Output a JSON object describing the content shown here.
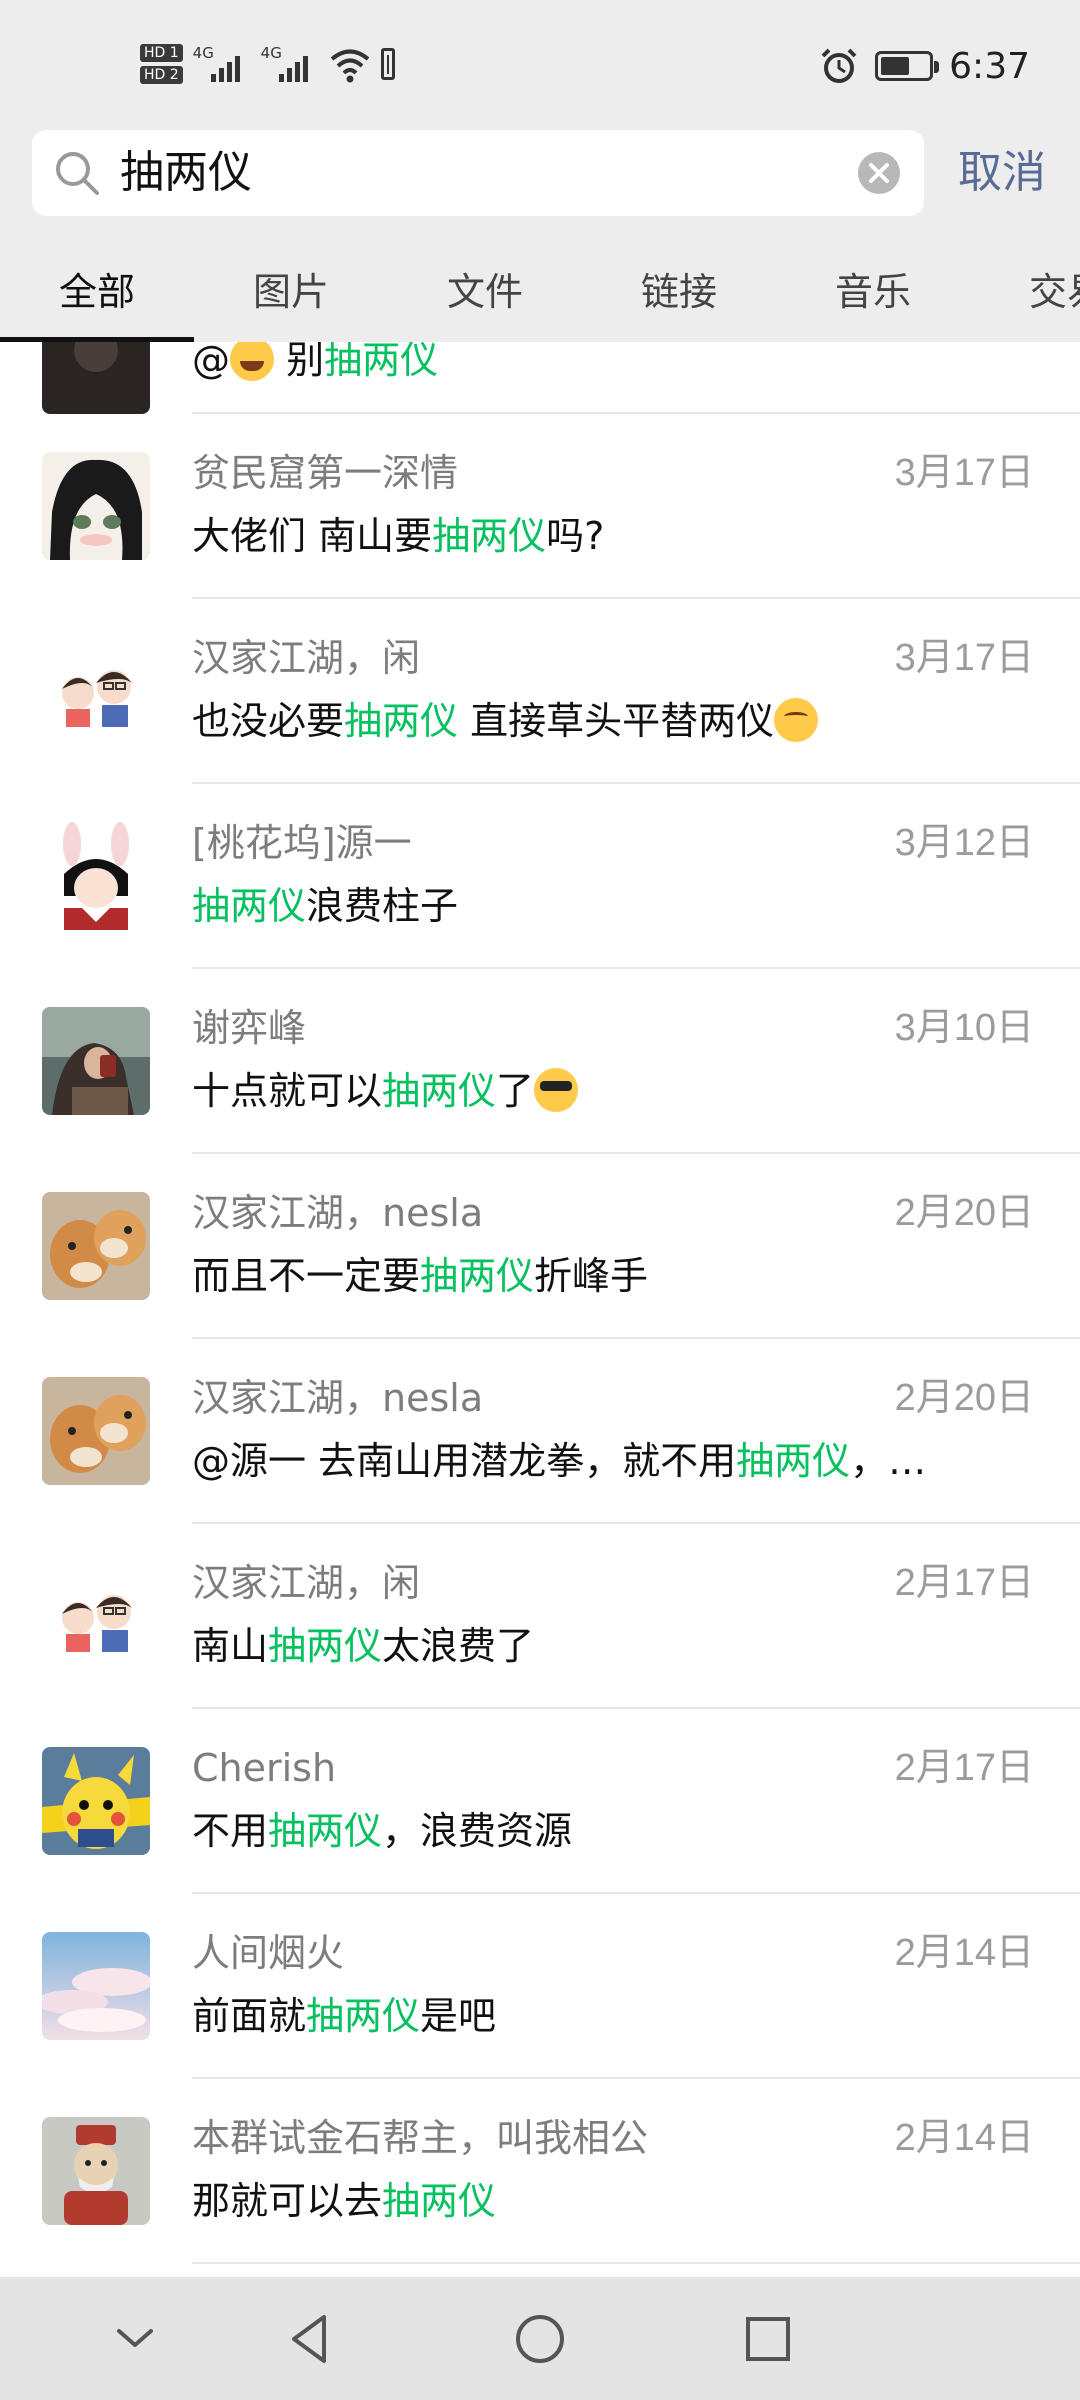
{
  "status_bar": {
    "sim_labels": [
      "HD 1",
      "HD 2"
    ],
    "network": [
      "4G",
      "4G"
    ],
    "battery_level": 0.6,
    "time": "6:37"
  },
  "search": {
    "query": "抽两仪",
    "cancel_label": "取消"
  },
  "tabs": [
    "全部",
    "图片",
    "文件",
    "链接",
    "音乐",
    "交易"
  ],
  "active_tab": "全部",
  "accent": "#07c160",
  "results": [
    {
      "name": "",
      "date": "",
      "msg_pre": "@",
      "emoji_mid": "laugh",
      "msg_mid": " 别",
      "highlight": "抽两仪",
      "msg_post": "",
      "emoji_end": "",
      "avatar": "dark"
    },
    {
      "name": "贫民窟第一深情",
      "date": "3月17日",
      "msg_pre": "大佬们 南山要",
      "highlight": "抽两仪",
      "msg_post": "吗?",
      "emoji_end": "",
      "avatar": "anime-girl"
    },
    {
      "name": "汉家江湖，闲",
      "date": "3月17日",
      "msg_pre": "也没必要",
      "highlight": "抽两仪",
      "msg_post": " 直接草头平替两仪",
      "emoji_end": "drool",
      "avatar": "couple"
    },
    {
      "name": "[桃花坞]源一",
      "date": "3月12日",
      "msg_pre": "",
      "highlight": "抽两仪",
      "msg_post": "浪费柱子",
      "emoji_end": "",
      "avatar": "bunny"
    },
    {
      "name": "谢弈峰",
      "date": "3月10日",
      "msg_pre": "十点就可以",
      "highlight": "抽两仪",
      "msg_post": "了",
      "emoji_end": "cool",
      "avatar": "photo-girl"
    },
    {
      "name": "汉家江湖，nesla",
      "date": "2月20日",
      "msg_pre": "而且不一定要",
      "highlight": "抽两仪",
      "msg_post": "折峰手",
      "emoji_end": "",
      "avatar": "shiba"
    },
    {
      "name": "汉家江湖，nesla",
      "date": "2月20日",
      "msg_pre": "@源一 去南山用潜龙拳，就不用",
      "highlight": "抽两仪",
      "msg_post": "，…",
      "emoji_end": "",
      "avatar": "shiba"
    },
    {
      "name": "汉家江湖，闲",
      "date": "2月17日",
      "msg_pre": "南山",
      "highlight": "抽两仪",
      "msg_post": "太浪费了",
      "emoji_end": "",
      "avatar": "couple"
    },
    {
      "name": "Cherish",
      "date": "2月17日",
      "msg_pre": "不用",
      "highlight": "抽两仪",
      "msg_post": "，浪费资源",
      "emoji_end": "",
      "avatar": "pikachu"
    },
    {
      "name": "人间烟火",
      "date": "2月14日",
      "msg_pre": "前面就",
      "highlight": "抽两仪",
      "msg_post": "是吧",
      "emoji_end": "",
      "avatar": "sky"
    },
    {
      "name": "本群试金石帮主，叫我相公",
      "date": "2月14日",
      "msg_pre": "那就可以去",
      "highlight": "抽两仪",
      "msg_post": "",
      "emoji_end": "",
      "avatar": "figure"
    }
  ],
  "nav_icons": [
    "chevron-down-icon",
    "back-icon",
    "home-icon",
    "recents-icon"
  ]
}
